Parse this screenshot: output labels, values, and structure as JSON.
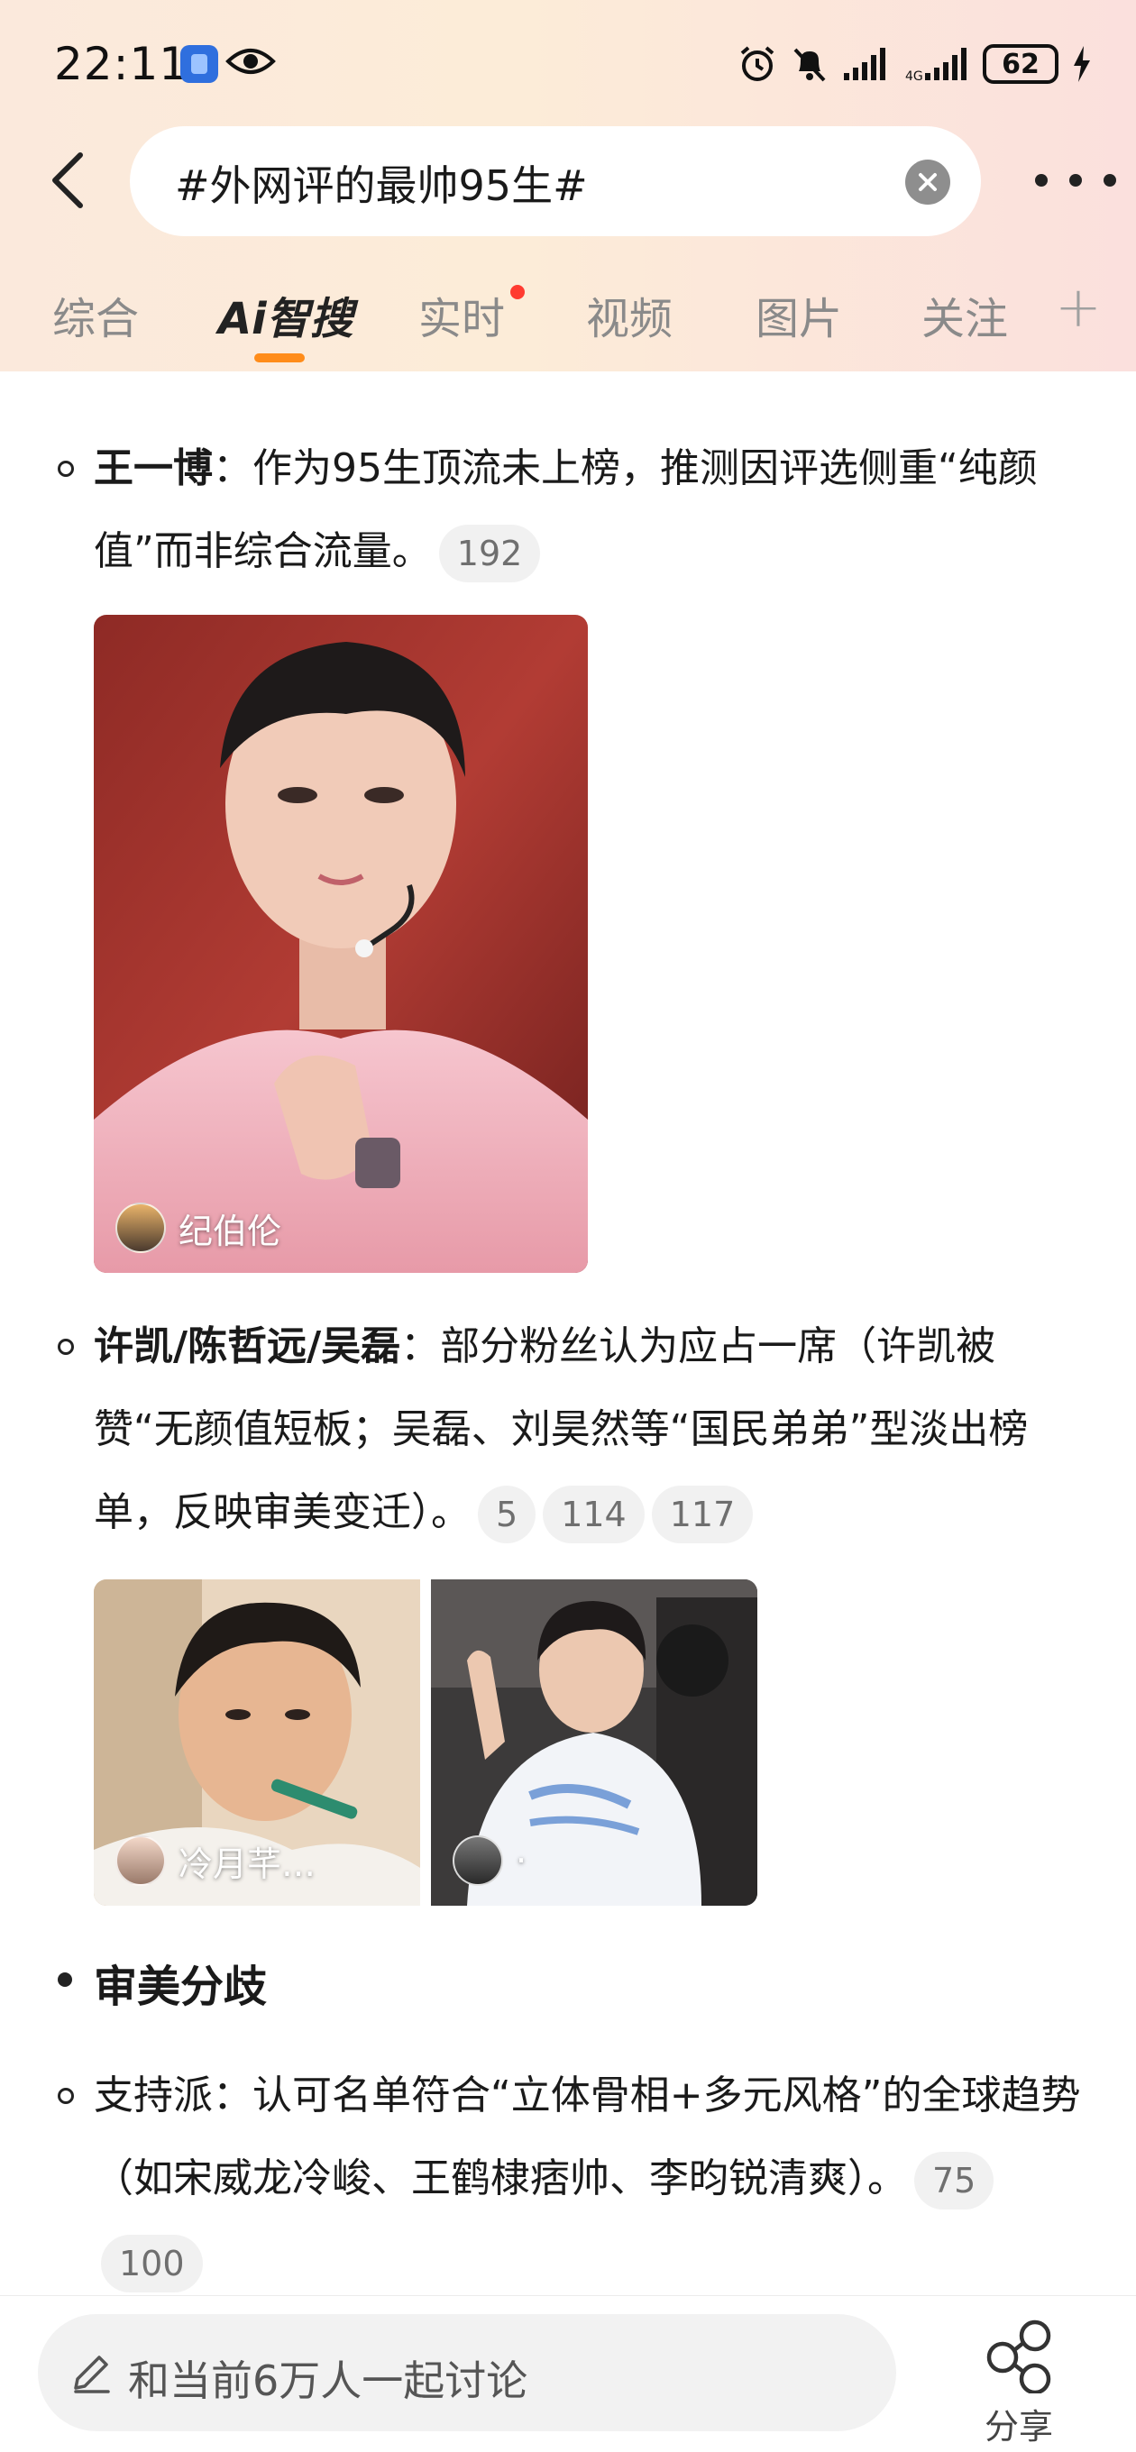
{
  "status_bar": {
    "time": "22:11",
    "battery": "62",
    "icons": [
      "app-icon",
      "eye-icon",
      "alarm-icon",
      "mute-icon",
      "signal-icon",
      "signal-icon",
      "battery-icon",
      "charging-icon"
    ]
  },
  "search": {
    "query": "#外网评的最帅95生#"
  },
  "tabs": [
    {
      "label": "综合",
      "active": false
    },
    {
      "label": "Ai智搜",
      "active": true
    },
    {
      "label": "实时",
      "active": false,
      "badge_dot": true
    },
    {
      "label": "视频",
      "active": false
    },
    {
      "label": "图片",
      "active": false
    },
    {
      "label": "关注",
      "active": false
    }
  ],
  "tab_plus": "+",
  "accent_color": "#ff8c1a",
  "content": {
    "item1": {
      "bold": "王一博",
      "text": "：作为95生顶流未上榜，推测因评选侧重“纯颜值”而非综合流量。",
      "refs": [
        "192"
      ],
      "photo_caption": "纪伯伦"
    },
    "item2": {
      "bold": "许凯/陈哲远/吴磊",
      "text": "：部分粉丝认为应占一席（许凯被赞“无颜值短板；吴磊、刘昊然等“国民弟弟”型淡出榜单，反映审美变迁）。",
      "refs": [
        "5",
        "114",
        "117"
      ],
      "photo1_caption": "冷月芊…",
      "photo2_caption": "·"
    },
    "section_title": "审美分歧",
    "item3": {
      "text": "支持派：认可名单符合“立体骨相+多元风格”的全球趋势（如宋威龙冷峻、王鹤棣痞帅、李昀锐清爽）。",
      "refs": [
        "75",
        "100"
      ]
    }
  },
  "bottom_bar": {
    "comment_placeholder": "和当前6万人一起讨论",
    "share_label": "分享"
  }
}
